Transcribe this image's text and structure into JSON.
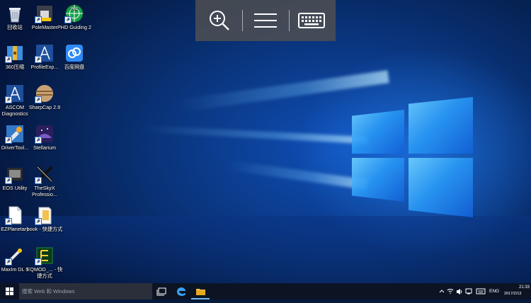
{
  "toolbar": {
    "zoom_icon": "zoom-in-icon",
    "menu_icon": "hamburger-icon",
    "keyboard_icon": "keyboard-icon"
  },
  "desktop_icons": [
    {
      "label": "回收站",
      "icon": "recycle-bin-icon"
    },
    {
      "label": "PoleMaster",
      "icon": "polemaster-icon"
    },
    {
      "label": "PHD Guiding 2",
      "icon": "phd-guiding-icon"
    },
    {
      "label": "360压缩",
      "icon": "zip-icon"
    },
    {
      "label": "ProfileExp...",
      "icon": "ascom-profile-icon"
    },
    {
      "label": "百度网盘",
      "icon": "baidu-netdisk-icon"
    },
    {
      "label": "ASCOM Diagnostics",
      "icon": "ascom-diagnostics-icon"
    },
    {
      "label": "SharpCap 2.9",
      "icon": "sharpcap-icon"
    },
    {
      "label": "DriverTool...",
      "icon": "drivertool-icon"
    },
    {
      "label": "Stellarium",
      "icon": "stellarium-icon"
    },
    {
      "label": "EOS Utility",
      "icon": "eos-utility-icon"
    },
    {
      "label": "TheSkyX Professio...",
      "icon": "theskyx-icon"
    },
    {
      "label": "EZPlanetary",
      "icon": "document-icon"
    },
    {
      "label": "book - 快捷方式",
      "icon": "folder-icon"
    },
    {
      "label": "MaxIm DL 5",
      "icon": "maxim-dl-icon"
    },
    {
      "label": "EQMOD_... - 快捷方式",
      "icon": "eqmod-icon"
    }
  ],
  "taskbar": {
    "search_placeholder": "搜索 Web 和 Windows",
    "language": "ENG",
    "time": "21:33",
    "date": "2017/2/13"
  },
  "colors": {
    "taskbar": "#0c1424",
    "search_box": "#2a2f3a",
    "accent": "#2a98f5"
  }
}
